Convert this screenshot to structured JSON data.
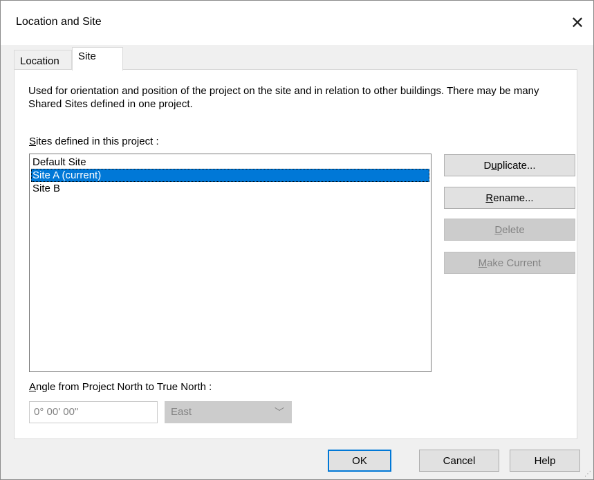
{
  "window": {
    "title": "Location and Site",
    "close_icon": "close-icon"
  },
  "tabs": [
    {
      "label": "Location",
      "active": false
    },
    {
      "label": "Site",
      "active": true
    }
  ],
  "site_tab": {
    "description": "Used for orientation and position of the project on the site and in relation to other buildings. There may be many Shared Sites defined in one project.",
    "sites_label": "Sites defined in this project :",
    "sites": [
      {
        "name": "Default Site",
        "selected": false
      },
      {
        "name": "Site A (current)",
        "selected": true
      },
      {
        "name": "Site B",
        "selected": false
      }
    ],
    "buttons": {
      "duplicate": "Duplicate...",
      "rename": "Rename...",
      "delete": "Delete",
      "make_current": "Make Current"
    },
    "angle_label": "Angle from Project North to True North :",
    "angle_value": "0° 00' 00\"",
    "direction_value": "East"
  },
  "footer": {
    "ok": "OK",
    "cancel": "Cancel",
    "help": "Help"
  },
  "colors": {
    "selection": "#0078d7",
    "disabled_bg": "#cccccc",
    "disabled_text": "#838383"
  }
}
